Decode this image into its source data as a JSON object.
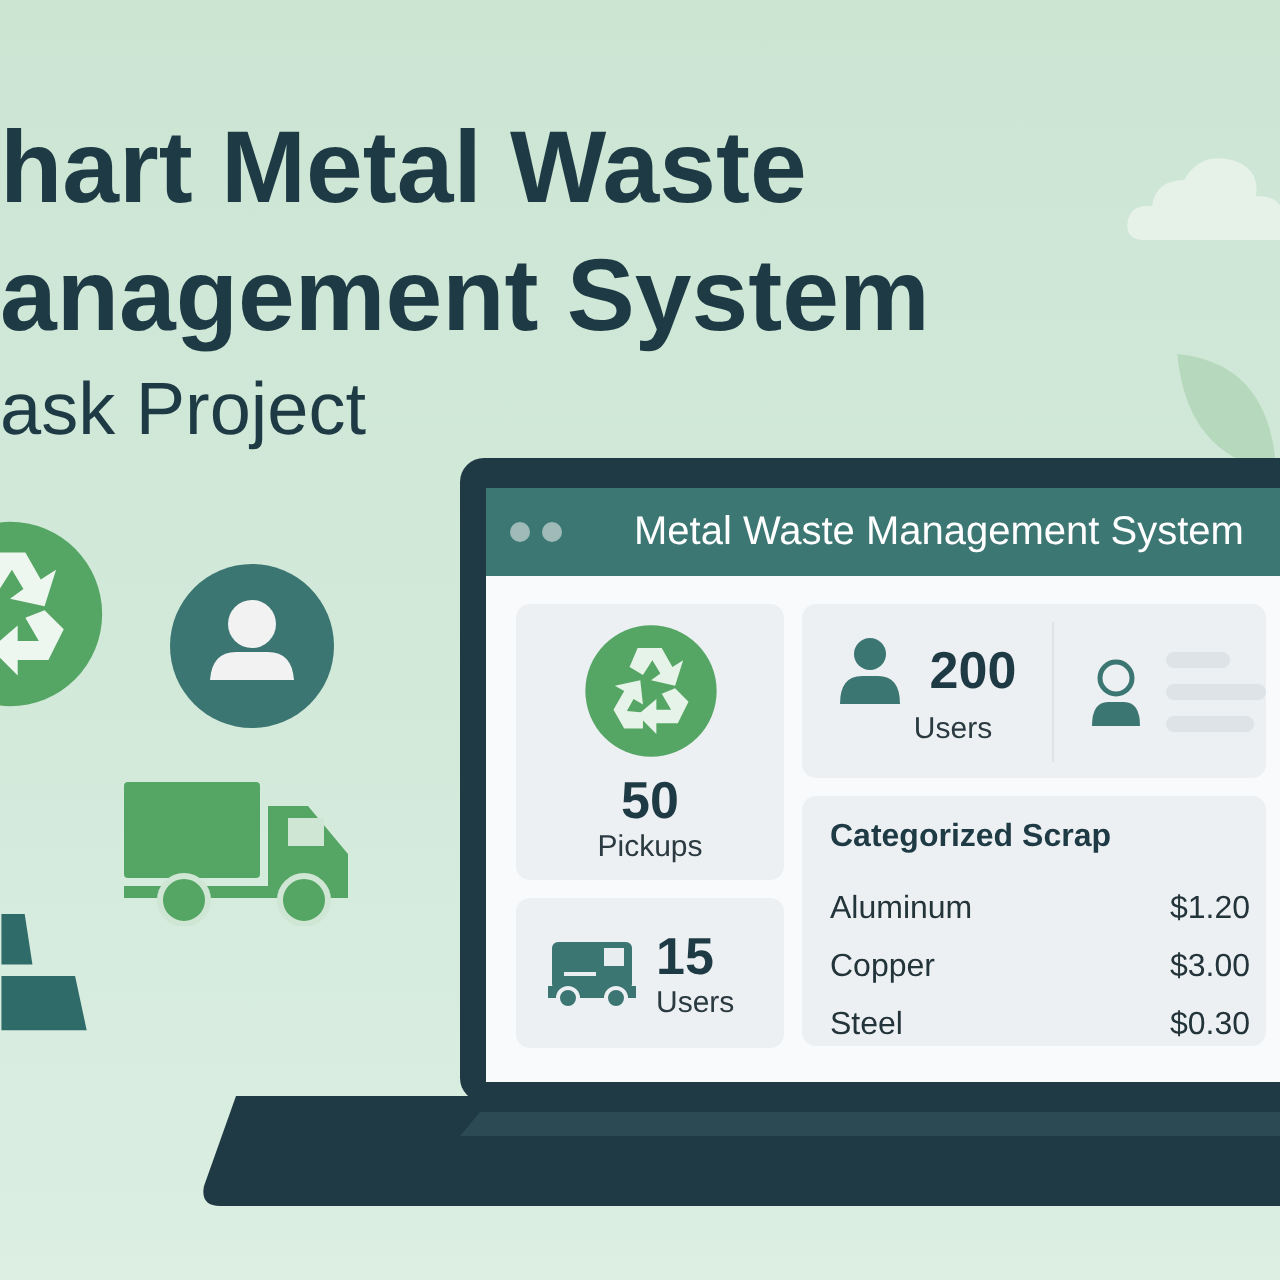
{
  "hero": {
    "title_lines": [
      "hart Metal Waste",
      "anagement System"
    ],
    "subtitle": "ask Project"
  },
  "app": {
    "window_title": "Metal Waste Management System",
    "pickups": {
      "value": "50",
      "label": "Pickups"
    },
    "fleet": {
      "value": "15",
      "label": "Users"
    },
    "users": {
      "value": "200",
      "label": "Users"
    },
    "scrap": {
      "title": "Categorized Scrap",
      "rows": [
        {
          "name": "Aluminum",
          "price": "$1.20"
        },
        {
          "name": "Copper",
          "price": "$3.00"
        },
        {
          "name": "Steel",
          "price": "$0.30"
        }
      ]
    }
  }
}
